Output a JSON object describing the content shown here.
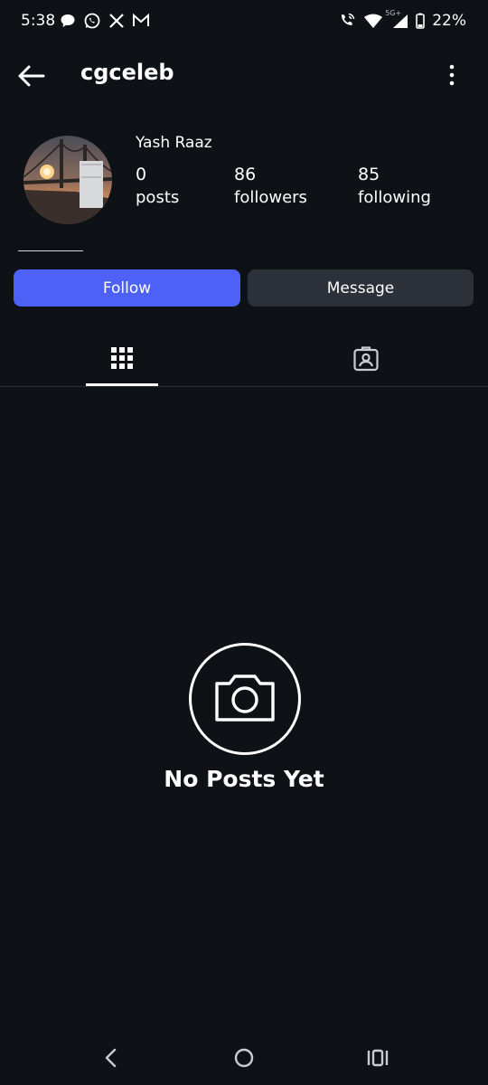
{
  "status_bar": {
    "time": "5:38",
    "battery": "22%",
    "network": "5G+",
    "left_icons": [
      "chat-bubble-icon",
      "whatsapp-icon",
      "x-icon",
      "gmail-icon"
    ],
    "right_icons": [
      "wifi-call-icon",
      "wifi-icon",
      "signal-icon",
      "battery-icon"
    ]
  },
  "header": {
    "username": "cgceleb",
    "back_icon": "arrow-left-icon",
    "more_icon": "more-vertical-icon"
  },
  "profile": {
    "full_name": "Yash Raaz",
    "stats": [
      {
        "value": "0",
        "label": "posts"
      },
      {
        "value": "86",
        "label": "followers"
      },
      {
        "value": "85",
        "label": "following"
      }
    ]
  },
  "actions": {
    "follow_label": "Follow",
    "message_label": "Message"
  },
  "tabs": [
    {
      "icon": "grid-icon",
      "selected": true
    },
    {
      "icon": "tagged-person-icon",
      "selected": false
    }
  ],
  "empty_state": {
    "icon": "camera-icon",
    "title": "No Posts Yet"
  },
  "nav_bar": {
    "icons": [
      "back-nav-icon",
      "home-nav-icon",
      "recents-nav-icon"
    ]
  },
  "colors": {
    "background": "#0e1116",
    "primary": "#4e61f6",
    "secondary_button": "#2c3038",
    "text": "#ffffff"
  }
}
